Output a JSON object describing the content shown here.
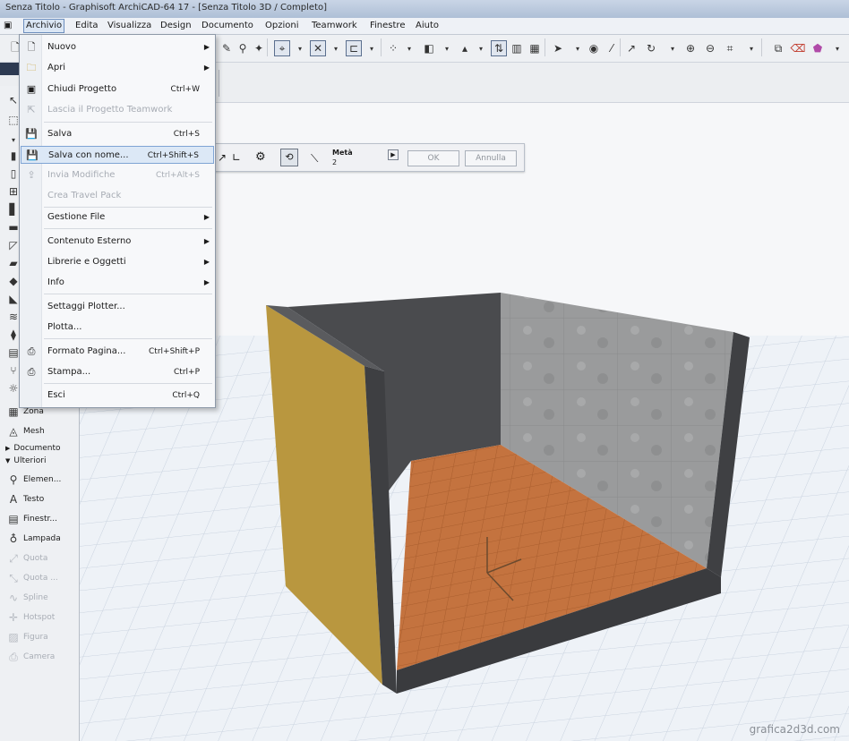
{
  "window": {
    "title": "Senza Titolo - Graphisoft ArchiCAD-64 17 - [Senza Titolo 3D / Completo]"
  },
  "menubar": {
    "items": [
      "Archivio",
      "Edita",
      "Visualizza",
      "Design",
      "Documento",
      "Opzioni",
      "Teamwork",
      "Finestre",
      "Aiuto"
    ]
  },
  "file_menu": {
    "items": [
      {
        "label": "Nuovo",
        "shortcut": "",
        "submenu": true,
        "enabled": true,
        "icon": "new-doc-icon"
      },
      {
        "label": "Apri",
        "shortcut": "",
        "submenu": true,
        "enabled": true,
        "icon": "open-folder-icon"
      },
      {
        "label": "Chiudi Progetto",
        "shortcut": "Ctrl+W",
        "submenu": false,
        "enabled": true,
        "icon": "close-project-icon"
      },
      {
        "label": "Lascia il Progetto Teamwork",
        "shortcut": "",
        "submenu": false,
        "enabled": false,
        "icon": "teamwork-leave-icon"
      },
      {
        "label": "Salva",
        "shortcut": "Ctrl+S",
        "submenu": false,
        "enabled": true,
        "icon": "save-icon"
      },
      {
        "label": "Salva con nome...",
        "shortcut": "Ctrl+Shift+S",
        "submenu": false,
        "enabled": true,
        "highlighted": true,
        "icon": "save-as-icon"
      },
      {
        "label": "Invia Modifiche",
        "shortcut": "Ctrl+Alt+S",
        "submenu": false,
        "enabled": false,
        "icon": "send-changes-icon"
      },
      {
        "label": "Crea Travel Pack",
        "shortcut": "",
        "submenu": false,
        "enabled": false,
        "icon": ""
      },
      {
        "label": "Gestione File",
        "shortcut": "",
        "submenu": true,
        "enabled": true,
        "icon": ""
      },
      {
        "label": "Contenuto Esterno",
        "shortcut": "",
        "submenu": true,
        "enabled": true,
        "icon": ""
      },
      {
        "label": "Librerie e Oggetti",
        "shortcut": "",
        "submenu": true,
        "enabled": true,
        "icon": ""
      },
      {
        "label": "Info",
        "shortcut": "",
        "submenu": true,
        "enabled": true,
        "icon": ""
      },
      {
        "label": "Settaggi Plotter...",
        "shortcut": "",
        "submenu": false,
        "enabled": true,
        "icon": ""
      },
      {
        "label": "Plotta...",
        "shortcut": "",
        "submenu": false,
        "enabled": true,
        "icon": ""
      },
      {
        "label": "Formato Pagina...",
        "shortcut": "Ctrl+Shift+P",
        "submenu": false,
        "enabled": true,
        "icon": "page-setup-icon"
      },
      {
        "label": "Stampa...",
        "shortcut": "Ctrl+P",
        "submenu": false,
        "enabled": true,
        "icon": "printer-icon"
      },
      {
        "label": "Esci",
        "shortcut": "Ctrl+Q",
        "submenu": false,
        "enabled": true,
        "icon": ""
      }
    ]
  },
  "palette": {
    "items_top": [
      {
        "label": "Zona",
        "icon": "zone-icon",
        "enabled": true
      },
      {
        "label": "Mesh",
        "icon": "mesh-icon",
        "enabled": true
      }
    ],
    "sections": [
      "Documento",
      "Ulteriori"
    ],
    "items_more": [
      {
        "label": "Elemen...",
        "icon": "object-icon",
        "enabled": true
      },
      {
        "label": "Testo",
        "icon": "text-icon",
        "enabled": true
      },
      {
        "label": "Finestr...",
        "icon": "window-icon",
        "enabled": true
      },
      {
        "label": "Lampada",
        "icon": "lamp-icon",
        "enabled": true
      },
      {
        "label": "Quota",
        "icon": "dimension-icon",
        "enabled": false
      },
      {
        "label": "Quota ...",
        "icon": "level-dimension-icon",
        "enabled": false
      },
      {
        "label": "Spline",
        "icon": "spline-icon",
        "enabled": false
      },
      {
        "label": "Hotspot",
        "icon": "hotspot-icon",
        "enabled": false
      },
      {
        "label": "Figura",
        "icon": "figure-icon",
        "enabled": false
      },
      {
        "label": "Camera",
        "icon": "camera-icon",
        "enabled": false
      }
    ]
  },
  "infobox": {
    "field_label": "Metà",
    "field_value": "2",
    "ok_label": "OK",
    "cancel_label": "Annulla"
  },
  "watermark": "grafica2d3d.com",
  "colors": {
    "accent": "#7fa4d4",
    "highlight": "#dce8f6",
    "floor": "#c4733f",
    "wall_dark": "#4a4b4e",
    "wall_concrete": "#9a9b9c",
    "wall_yellow": "#b9973f"
  }
}
